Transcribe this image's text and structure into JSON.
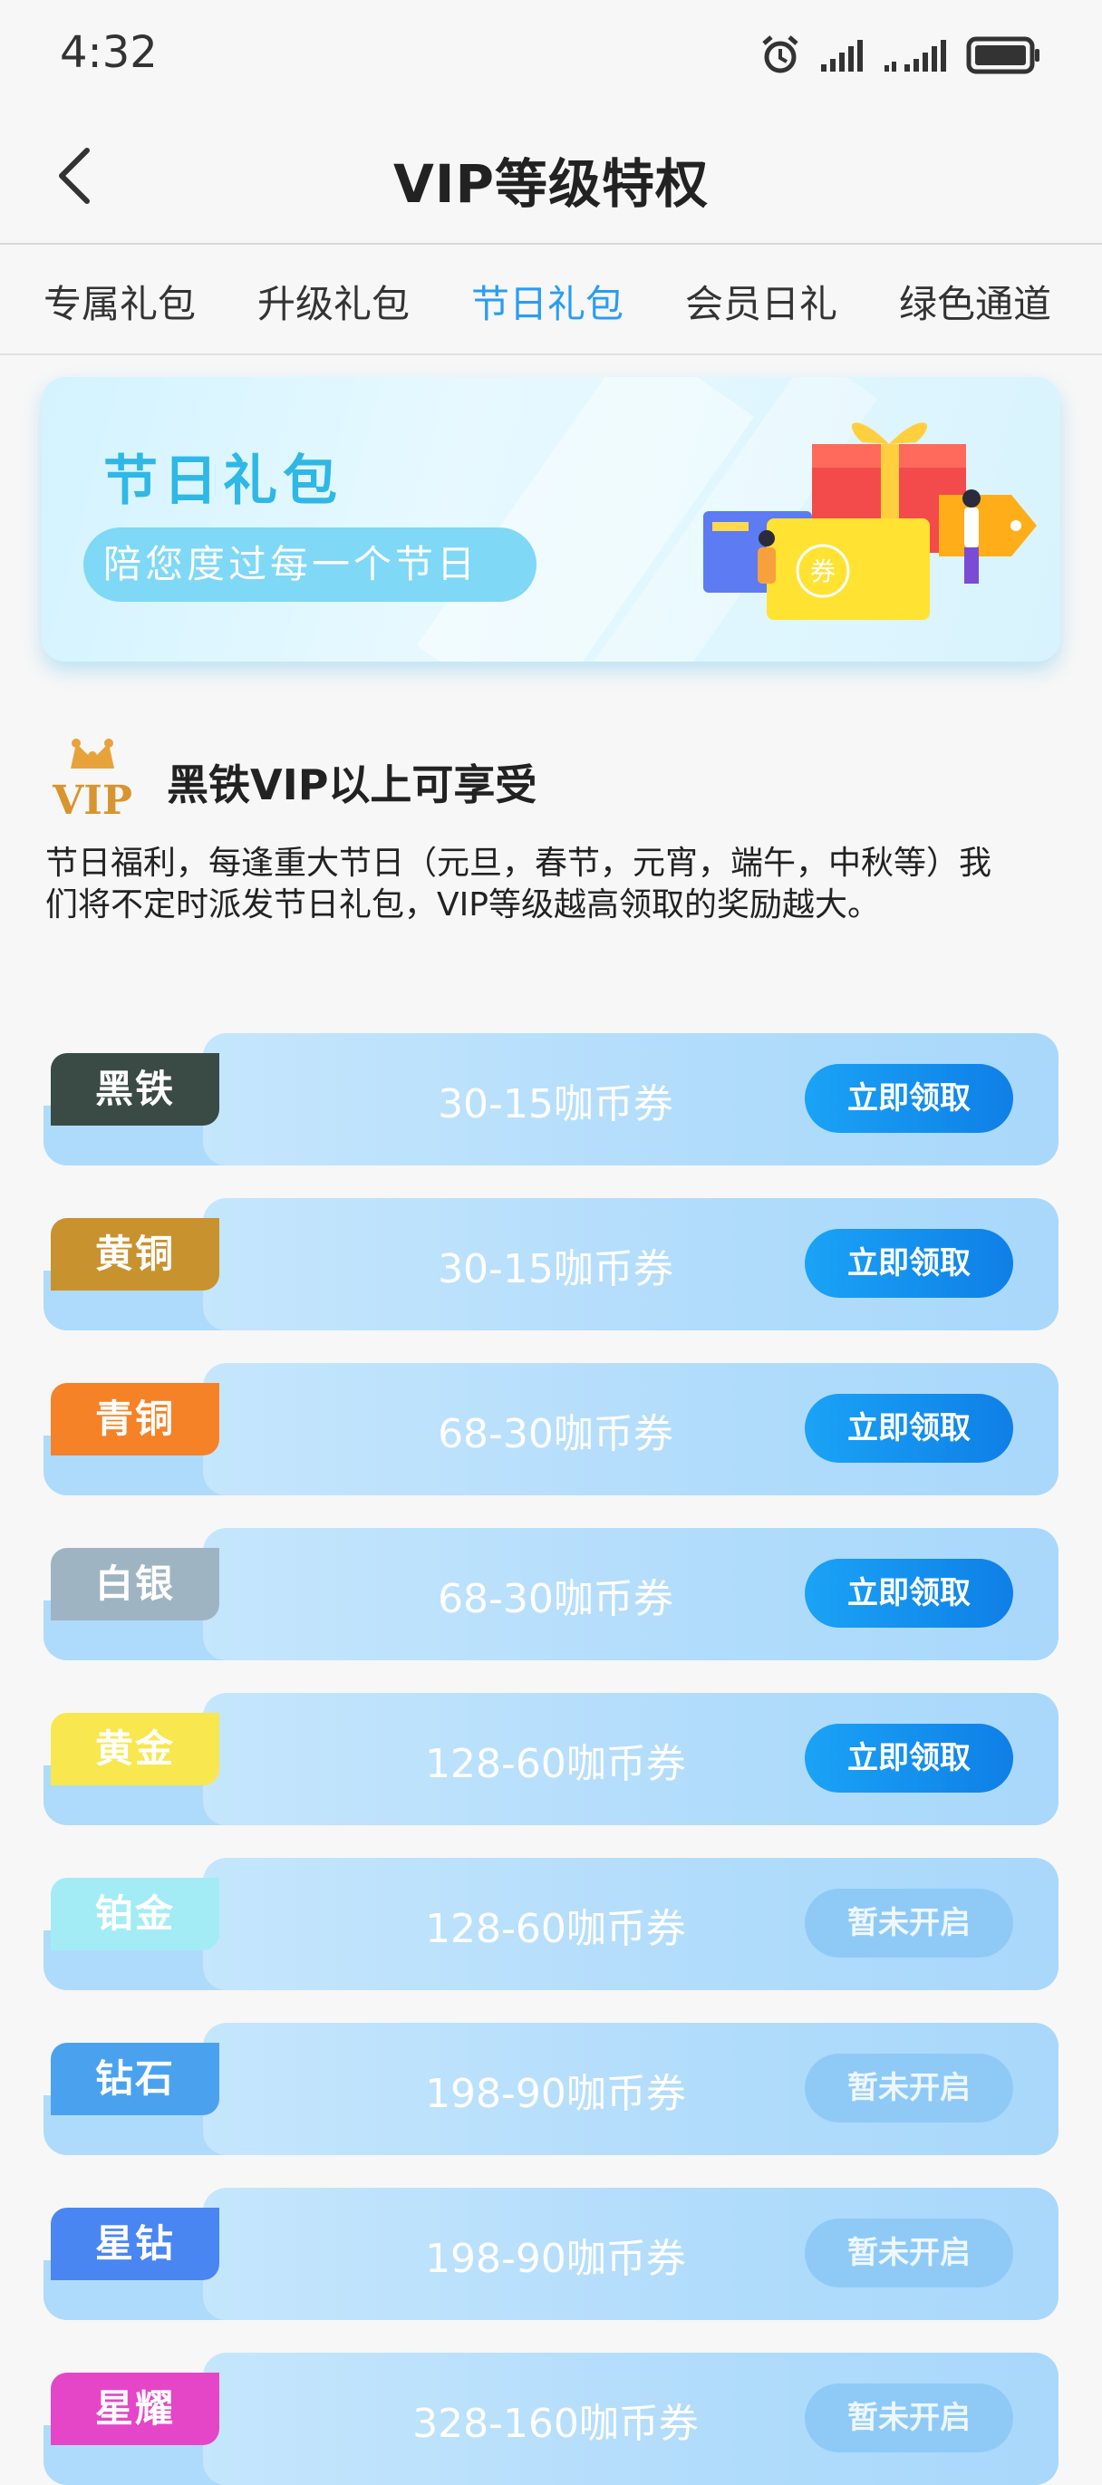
{
  "status_bar": {
    "time": "4:32",
    "icons": [
      "alarm-icon",
      "signal-icon",
      "signal-icon-2",
      "battery-icon"
    ]
  },
  "header": {
    "title": "VIP等级特权",
    "back_icon": "back-arrow-icon"
  },
  "tabs": [
    {
      "label": "专属礼包",
      "active": false
    },
    {
      "label": "升级礼包",
      "active": false
    },
    {
      "label": "节日礼包",
      "active": true
    },
    {
      "label": "会员日礼",
      "active": false
    },
    {
      "label": "绿色通道",
      "active": false
    }
  ],
  "banner": {
    "title": "节日礼包",
    "subtitle": "陪您度过每一个节日",
    "coupon_label": "券"
  },
  "vip_section": {
    "logo_text": "VIP",
    "heading": "黑铁VIP以上可享受",
    "description": " 节日福利，每逢重大节日（元旦，春节，元宵，端午，中秋等）我们将不定时派发节日礼包，VIP等级越高领取的奖励越大。"
  },
  "colors": {
    "accent": "#2a9cf4",
    "button_active": "#1a8ff0",
    "button_disabled": "#8fcaf7"
  },
  "levels": [
    {
      "name": "黑铁",
      "color": "#3a4a44",
      "coupon": "30-15咖币券",
      "button": "立即领取",
      "enabled": true
    },
    {
      "name": "黄铜",
      "color": "#c8922e",
      "coupon": "30-15咖币券",
      "button": "立即领取",
      "enabled": true
    },
    {
      "name": "青铜",
      "color": "#f58226",
      "coupon": "68-30咖币券",
      "button": "立即领取",
      "enabled": true
    },
    {
      "name": "白银",
      "color": "#9fb4c2",
      "coupon": "68-30咖币券",
      "button": "立即领取",
      "enabled": true
    },
    {
      "name": "黄金",
      "color": "#f8e74e",
      "coupon": "128-60咖币券",
      "button": "立即领取",
      "enabled": true
    },
    {
      "name": "铂金",
      "color": "#a3ecf6",
      "coupon": "128-60咖币券",
      "button": "暂未开启",
      "enabled": false
    },
    {
      "name": "钻石",
      "color": "#4aa2ef",
      "coupon": "198-90咖币券",
      "button": "暂未开启",
      "enabled": false
    },
    {
      "name": "星钻",
      "color": "#4a86f2",
      "coupon": "198-90咖币券",
      "button": "暂未开启",
      "enabled": false
    },
    {
      "name": "星耀",
      "color": "#e546c8",
      "coupon": "328-160咖币券",
      "button": "暂未开启",
      "enabled": false
    }
  ]
}
